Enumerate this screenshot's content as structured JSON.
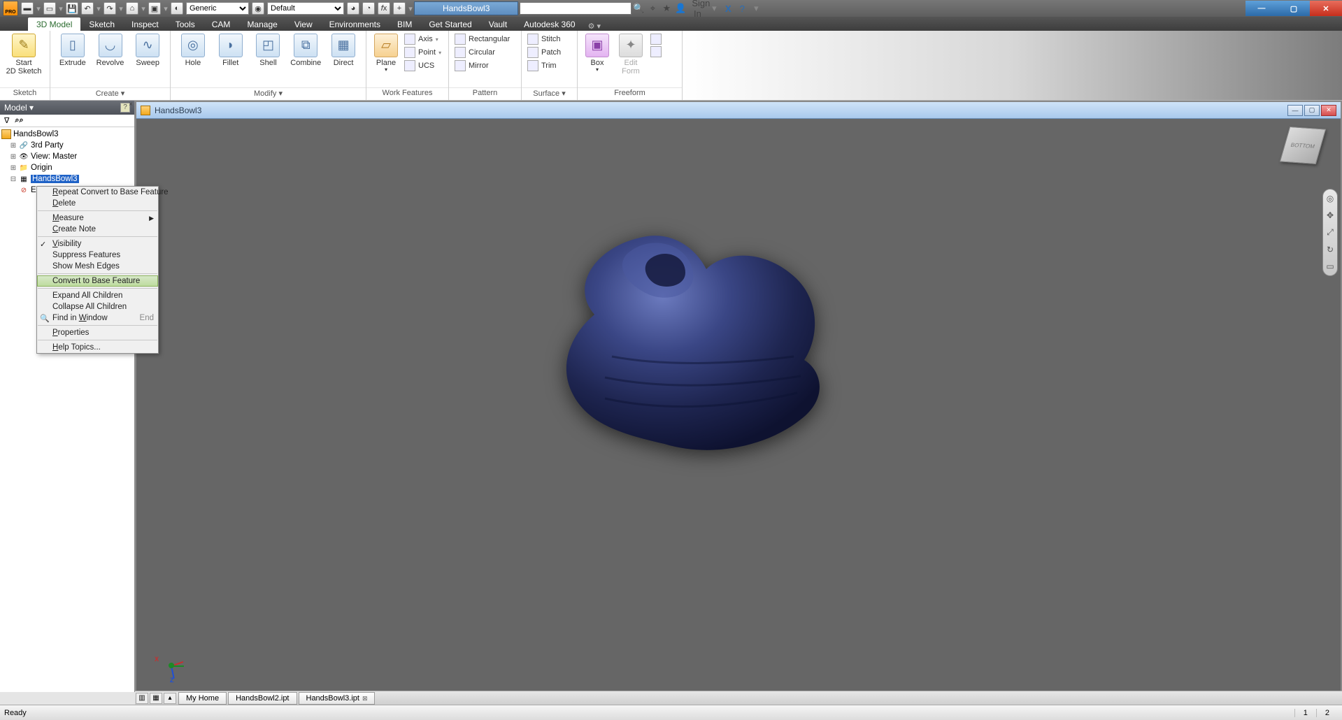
{
  "app": {
    "logo_text": "PRO",
    "doc_tab": "HandsBowl3",
    "signin": "Sign In"
  },
  "qat": {
    "material_label": "Generic",
    "appearance_label": "Default"
  },
  "menutabs": [
    "3D Model",
    "Sketch",
    "Inspect",
    "Tools",
    "CAM",
    "Manage",
    "View",
    "Environments",
    "BIM",
    "Get Started",
    "Vault",
    "Autodesk 360"
  ],
  "ribbon": {
    "sketch": {
      "start2d": "Start\n2D Sketch",
      "label": "Sketch"
    },
    "create": {
      "extrude": "Extrude",
      "revolve": "Revolve",
      "sweep": "Sweep",
      "label": "Create ▾"
    },
    "modify": {
      "hole": "Hole",
      "fillet": "Fillet",
      "shell": "Shell",
      "combine": "Combine",
      "direct": "Direct",
      "label": "Modify ▾"
    },
    "work": {
      "plane": "Plane",
      "axis": "Axis",
      "point": "Point",
      "ucs": "UCS",
      "label": "Work Features"
    },
    "pattern": {
      "rect": "Rectangular",
      "circ": "Circular",
      "mirror": "Mirror",
      "label": "Pattern"
    },
    "surface": {
      "stitch": "Stitch",
      "patch": "Patch",
      "trim": "Trim",
      "label": "Surface ▾"
    },
    "freeform": {
      "box": "Box",
      "edit": "Edit\nForm",
      "label": "Freeform"
    }
  },
  "browser": {
    "title": "Model ▾",
    "root": "HandsBowl3",
    "nodes": {
      "thirdparty": "3rd Party",
      "view": "View: Master",
      "origin": "Origin",
      "selected": "HandsBowl3",
      "end": "End of Part"
    }
  },
  "viewport": {
    "title": "HandsBowl3",
    "cube": "BOTTOM"
  },
  "context": {
    "items": [
      {
        "t": "Repeat Convert to Base Feature",
        "u": "R"
      },
      {
        "t": "Delete",
        "u": "D"
      },
      {
        "sep": true
      },
      {
        "t": "Measure",
        "u": "M",
        "sub": true
      },
      {
        "t": "Create Note",
        "u": "C"
      },
      {
        "sep": true
      },
      {
        "t": "Visibility",
        "u": "V",
        "chk": true
      },
      {
        "t": "Suppress Features"
      },
      {
        "t": "Show Mesh Edges"
      },
      {
        "sep": true
      },
      {
        "t": "Convert to Base Feature",
        "hl": true
      },
      {
        "sep": true
      },
      {
        "t": "Expand All Children"
      },
      {
        "t": "Collapse All Children"
      },
      {
        "t": "Find in Window",
        "u": "W",
        "hint": "End",
        "icon": true
      },
      {
        "sep": true
      },
      {
        "t": "Properties",
        "u": "P"
      },
      {
        "sep": true
      },
      {
        "t": "Help Topics...",
        "u": "H"
      }
    ]
  },
  "doctabs": {
    "home": "My Home",
    "t1": "HandsBowl2.ipt",
    "t2": "HandsBowl3.ipt"
  },
  "status": {
    "ready": "Ready",
    "n1": "1",
    "n2": "2"
  },
  "triad": {
    "x": "X",
    "y": "",
    "z": "Z"
  }
}
